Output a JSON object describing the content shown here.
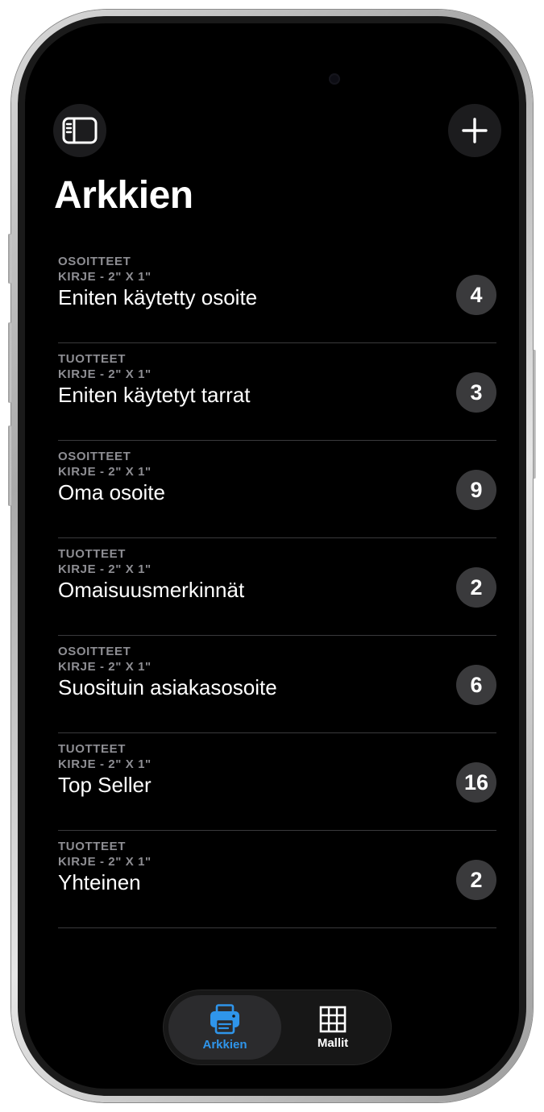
{
  "header": {
    "title": "Arkkien"
  },
  "sheets": [
    {
      "category": "OSOITTEET",
      "format": "KIRJE - 2\" X 1\"",
      "name": "Eniten käytetty osoite",
      "count": "4"
    },
    {
      "category": "TUOTTEET",
      "format": "KIRJE - 2\" X 1\"",
      "name": "Eniten käytetyt tarrat",
      "count": "3"
    },
    {
      "category": "OSOITTEET",
      "format": "KIRJE - 2\" X 1\"",
      "name": "Oma osoite",
      "count": "9"
    },
    {
      "category": "TUOTTEET",
      "format": "KIRJE - 2\" X 1\"",
      "name": "Omaisuusmerkinnät",
      "count": "2"
    },
    {
      "category": "OSOITTEET",
      "format": "KIRJE - 2\" X 1\"",
      "name": "Suosituin asiakasosoite",
      "count": "6"
    },
    {
      "category": "TUOTTEET",
      "format": "KIRJE - 2\" X 1\"",
      "name": "Top Seller",
      "count": "16"
    },
    {
      "category": "TUOTTEET",
      "format": "KIRJE - 2\" X 1\"",
      "name": "Yhteinen",
      "count": "2"
    }
  ],
  "tabs": [
    {
      "label": "Arkkien",
      "icon": "printer-icon",
      "selected": true
    },
    {
      "label": "Mallit",
      "icon": "grid-icon",
      "selected": false
    }
  ],
  "toolbar": {
    "left_icon": "sidebar-icon",
    "right_icon": "plus-icon"
  },
  "colors": {
    "accent": "#2f95ea",
    "background": "#000000",
    "badge": "#3a3a3c",
    "secondary_text": "#8e8e93"
  }
}
